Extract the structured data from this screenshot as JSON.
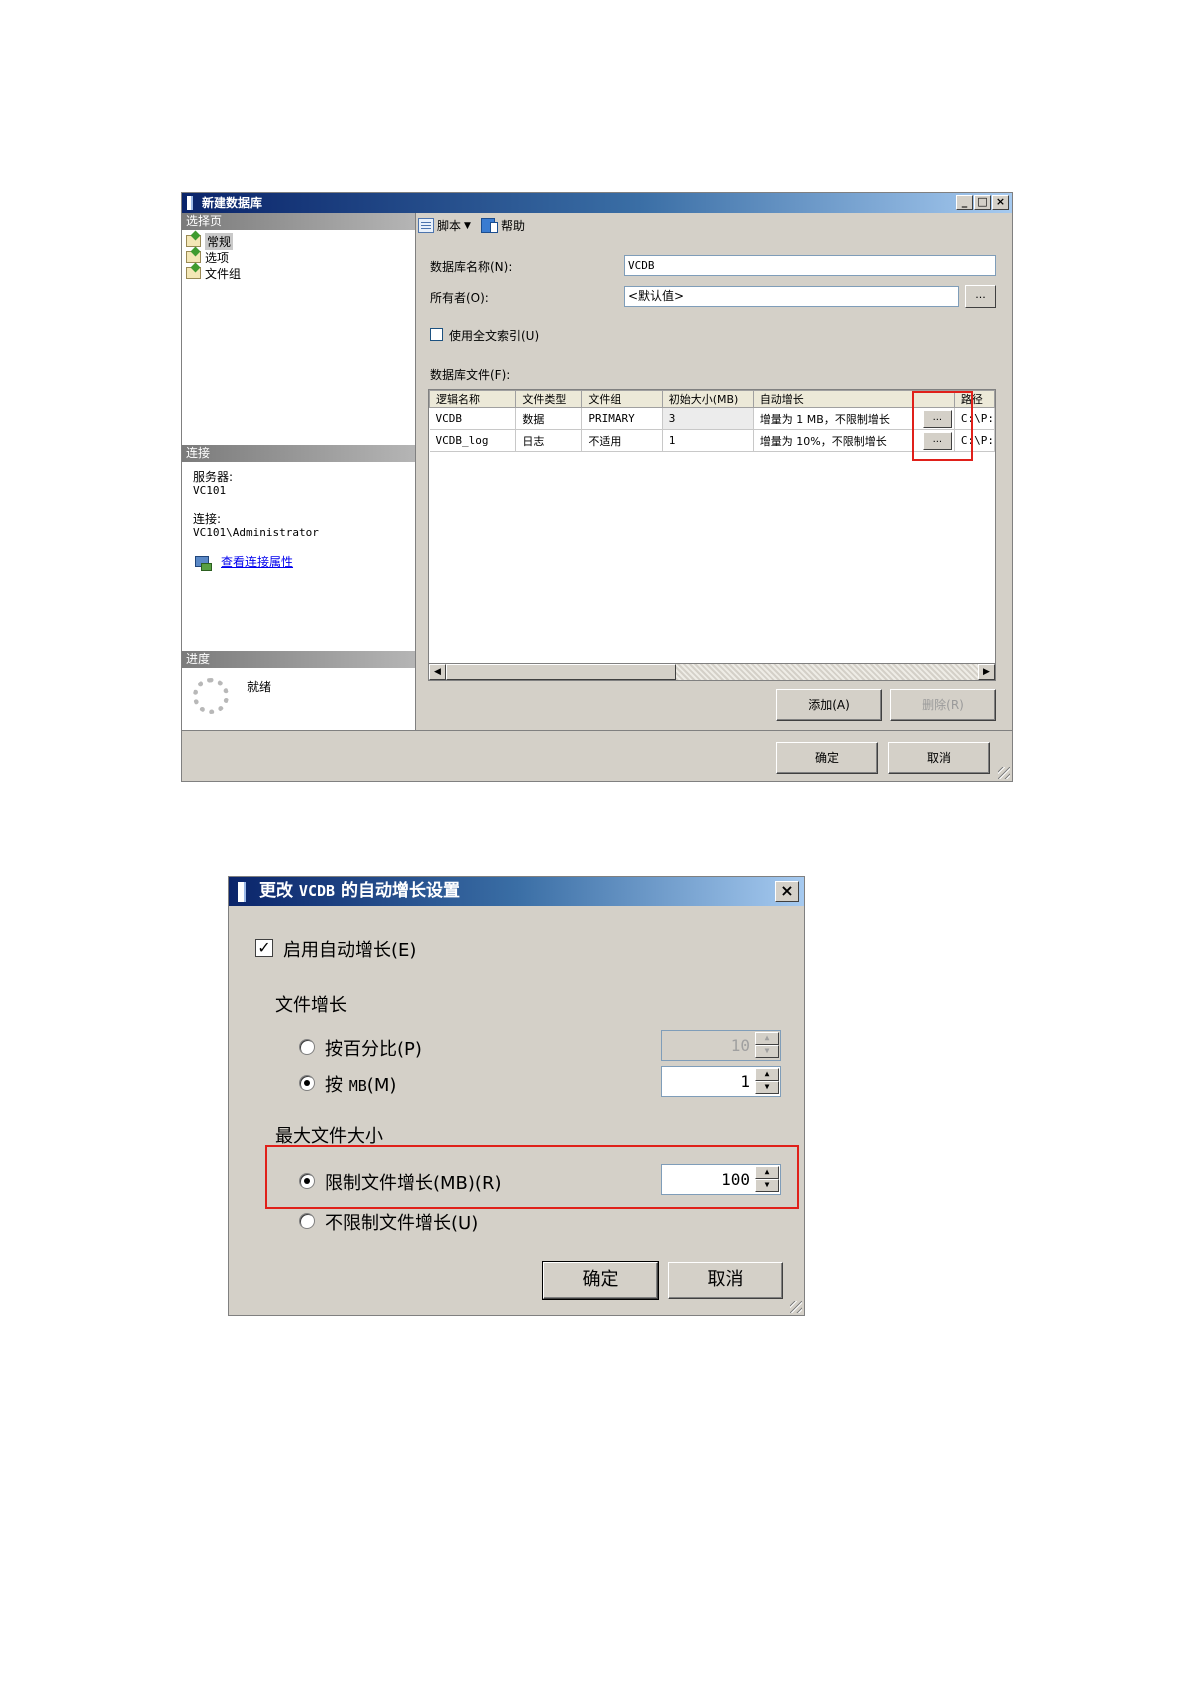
{
  "new_db_window": {
    "title": "新建数据库",
    "controls": {
      "minimize": "_",
      "maximize": "□",
      "close": "×"
    },
    "sidebar": {
      "select_page_header": "选择页",
      "pages": [
        "常规",
        "选项",
        "文件组"
      ],
      "selected_page": "常规",
      "connection_header": "连接",
      "server_label": "服务器:",
      "server_value": "VC101",
      "connection_label": "连接:",
      "connection_value": "VC101\\Administrator",
      "view_connection_link": "查看连接属性",
      "progress_header": "进度",
      "progress_status": "就绪"
    },
    "toolbar": {
      "script_label": "脚本",
      "help_label": "帮助"
    },
    "db_name_label": "数据库名称(N):",
    "db_name_value": "VCDB",
    "owner_label": "所有者(O):",
    "owner_value": "<默认值>",
    "ellipsis": "...",
    "fulltext_label": "使用全文索引(U)",
    "fulltext_checked": false,
    "db_files_label": "数据库文件(F):",
    "grid": {
      "columns": [
        "逻辑名称",
        "文件类型",
        "文件组",
        "初始大小(MB)",
        "自动增长",
        "路径"
      ],
      "rows": [
        {
          "name": "VCDB",
          "type": "数据",
          "filegroup": "PRIMARY",
          "size": "3",
          "growth": "增量为 1 MB，不限制增长",
          "path": "C:\\P:"
        },
        {
          "name": "VCDB_log",
          "type": "日志",
          "filegroup": "不适用",
          "size": "1",
          "growth": "增量为 10%，不限制增长",
          "path": "C:\\P:"
        }
      ]
    },
    "add_button": "添加(A)",
    "remove_button": "删除(R)",
    "ok_button": "确定",
    "cancel_button": "取消"
  },
  "autogrowth_dialog": {
    "title_prefix": "更改",
    "title_db": "VCDB",
    "title_suffix": "的自动增长设置",
    "close": "×",
    "enable_autogrowth_label": "启用自动增长(E)",
    "enable_autogrowth_checked": true,
    "file_growth_header": "文件增长",
    "by_percent_label": "按百分比(P)",
    "by_percent_value": "10",
    "by_mb_prefix": "按",
    "by_mb_unit": "MB",
    "by_mb_suffix": "(M)",
    "by_mb_value": "1",
    "selected_growth": "mb",
    "max_size_header": "最大文件大小",
    "limit_label": "限制文件增长(MB)(R)",
    "limit_value": "100",
    "unlimited_label": "不限制文件增长(U)",
    "selected_max": "limit",
    "ok_button": "确定",
    "cancel_button": "取消"
  },
  "highlight_color": "#e0201a"
}
